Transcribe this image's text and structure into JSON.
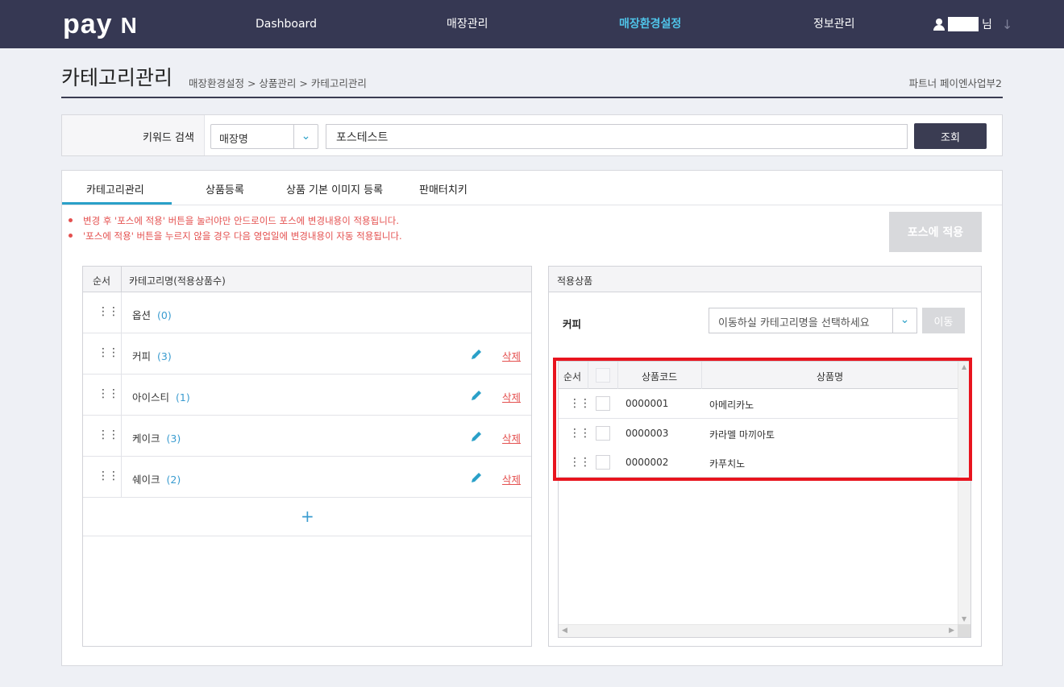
{
  "header": {
    "logo_text": "pay",
    "logo_mark": "N",
    "nav": [
      "Dashboard",
      "매장관리",
      "매장환경설정",
      "정보관리"
    ],
    "active_nav": "매장환경설정",
    "user_suffix": "님",
    "user_menu_arrow": "↓"
  },
  "page": {
    "title": "카테고리관리",
    "breadcrumb": "매장환경설정 > 상품관리 > 카테고리관리",
    "partner": "파트너 페이엔사업부2"
  },
  "search": {
    "label": "키워드 검색",
    "field_selected": "매장명",
    "keyword_value": "포스테스트",
    "button": "조회"
  },
  "tabs": [
    "카테고리관리",
    "상품등록",
    "상품 기본 이미지 등록",
    "판매터치키"
  ],
  "notices": [
    "변경 후 '포스에 적용' 버튼을 눌러야만 안드로이드 포스에 변경내용이 적용됩니다.",
    "'포스에 적용' 버튼을 누르지 않을 경우 다음 영업일에 변경내용이 자동 적용됩니다."
  ],
  "apply_button": "포스에 적용",
  "category_table": {
    "headers": [
      "순서",
      "카테고리명(적용상품수)"
    ],
    "rows": [
      {
        "name": "옵션",
        "count": "(0)",
        "delete": ""
      },
      {
        "name": "커피",
        "count": "(3)",
        "delete": "삭제"
      },
      {
        "name": "아이스티",
        "count": "(1)",
        "delete": "삭제"
      },
      {
        "name": "케이크",
        "count": "(3)",
        "delete": "삭제"
      },
      {
        "name": "쉐이크",
        "count": "(2)",
        "delete": "삭제"
      }
    ],
    "add_label": "+"
  },
  "applied_products": {
    "title": "적용상품",
    "current_category": "커피",
    "move_placeholder": "이동하실 카테고리명을 선택하세요",
    "move_button": "이동",
    "headers": [
      "순서",
      "상품코드",
      "상품명"
    ],
    "rows": [
      {
        "code": "0000001",
        "name": "아메리카노"
      },
      {
        "code": "0000003",
        "name": "카라멜 마끼아토"
      },
      {
        "code": "0000002",
        "name": "카푸치노"
      }
    ]
  },
  "colors": {
    "nav_bg": "#363853",
    "accent": "#2aa0c8",
    "danger": "#e4504f",
    "highlight": "#e8141e"
  }
}
